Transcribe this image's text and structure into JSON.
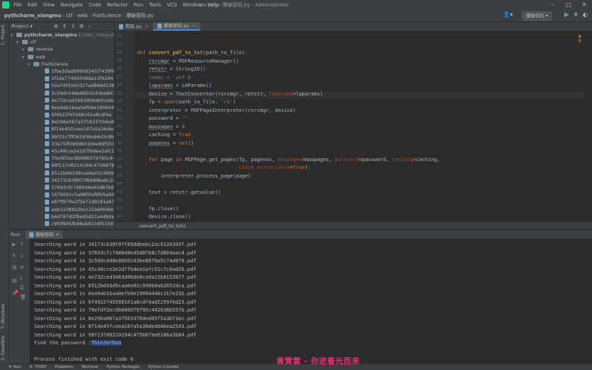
{
  "menubar": {
    "items": [
      "File",
      "Edit",
      "View",
      "Navigate",
      "Code",
      "Refactor",
      "Run",
      "Tools",
      "VCS",
      "Window",
      "Help"
    ],
    "title": "cscy.py - 爆破密码.py - Administrator"
  },
  "navbar": {
    "crumbs": [
      "pythcharm_xiangmu",
      "ctf",
      "web",
      "FlatScience",
      "爆破密码.py"
    ],
    "run_config": "爆破密码 ▾"
  },
  "left_strip": {
    "project_tab": "1: Project",
    "structure_tab": "7: Structure",
    "favorites_tab": "2: Favorites"
  },
  "project": {
    "header": "Project ▾",
    "root": "pythcharm_xiangmu",
    "root_path": "E:\\dax_mal\\pythch",
    "folders": [
      "ctf",
      "reverse",
      "web",
      "FlatScience"
    ],
    "files": [
      "1f0e3dad99908345f7439f8",
      "1f1de77400508da13f4294",
      "02e74f10e0327ad868d138f",
      "3c59dc048e8850243be8079",
      "4e732ced3463d06de0ca9a1",
      "6ea9ab1baa0efb9e190944",
      "6f4922f45568161a8cdf4a",
      "8e296a067a37563370ded0",
      "8f14e45fceea167a5a36ded",
      "9bf31c7ff062936a96d3c8b",
      "33e75ff09dd601bbe69f351",
      "45c48cce2e2d7fbdea1afc5",
      "70efdf2ec9b086079795c44",
      "98f13708210194c475687be",
      "6512bd43d9caa6e02c990b0",
      "34173cb38f07f89ddbebc2a",
      "37693cfc748049e45d87b8c",
      "1679091c5a880faf6fb5e608",
      "a87ff679a2f3e71d9181a67b",
      "aab3238922bcc25a6f606eb5",
      "b6d767d2f8ed5d21a44b0e5",
      "c9f0f895fb98ab9159f51fd0"
    ]
  },
  "editor": {
    "tabs": [
      "爬取.py",
      "爆破密码.py"
    ],
    "line_numbers": [
      "22",
      "23",
      "24",
      "25",
      "26",
      "27",
      "28",
      "29",
      "30",
      "31",
      "32",
      "33",
      "34",
      "35",
      "36",
      "37",
      "38",
      "39",
      "40",
      "41",
      "42",
      "43",
      "44",
      "45",
      "46"
    ],
    "code_lines": [
      {
        "n": "24",
        "html": "<span class='kw'>def </span><span class='fn'>convert_pdf_to_txt</span>(path_to_file):"
      },
      {
        "n": "25",
        "html": "    <span class='ul'>rsrcmgr</span> = PDFResourceManager()"
      },
      {
        "n": "26",
        "html": "    <span class='ul'>retstr</span> = StringIO()"
      },
      {
        "n": "27",
        "html": "    <span style='color:#808080'>codec = 'utf-8'</span>"
      },
      {
        "n": "28",
        "html": "    <span class='ul'>laparams</span> = LAParams()"
      },
      {
        "n": "29",
        "html": "    device = TextConverter(rsrcmgr, retstr, <span class='prm'>laparams</span>=laparams)"
      },
      {
        "n": "30",
        "html": "    fp = <span class='kw'>open</span>(path_to_file, <span class='str'>'rb'</span>)"
      },
      {
        "n": "31",
        "html": "    interpreter = PDFPageInterpreter(rsrcmgr, device)"
      },
      {
        "n": "32",
        "html": "    password = <span class='str'>\"\"</span>"
      },
      {
        "n": "33",
        "html": "    <span class='ul'>maxpages</span> = <span class='num'>0</span>"
      },
      {
        "n": "34",
        "html": "    caching = <span class='kw'>True</span>"
      },
      {
        "n": "35",
        "html": "    <span class='ul'>pagenos</span> = <span class='kw'>set</span>()"
      },
      {
        "n": "36",
        "html": ""
      },
      {
        "n": "37",
        "html": "    <span class='kw'>for </span>page <span class='kw'>in </span>PDFPage.get_pages(fp, pagenos, <span class='prm'>maxpages</span>=maxpages, <span class='prm'>password</span>=password, <span class='prm'>caching</span>=caching,"
      },
      {
        "n": "38",
        "html": "                                  <span class='prm'>check_extractable</span>=<span class='kw'>True</span>):"
      },
      {
        "n": "39",
        "html": "        interpreter.process_page(page)"
      },
      {
        "n": "40",
        "html": ""
      },
      {
        "n": "41",
        "html": "    text = retstr.getvalue()"
      },
      {
        "n": "42",
        "html": ""
      },
      {
        "n": "43",
        "html": "    fp.close()"
      },
      {
        "n": "44",
        "html": "    device.close()"
      }
    ],
    "breadcrumb": "convert_pdf_to_txt()",
    "warning": "▲ 8"
  },
  "run": {
    "label": "Run:",
    "tab": "爆破密码",
    "lines": [
      "Searching word in 34173cb38f07f89ddbebc2ac9128303f.pdf",
      "Searching word in 37693cfc748049e45d87b8c7d8b9aacd.pdf",
      "Searching word in 3c59dc048e8850243be8079a5c74d079.pdf",
      "Searching word in 45c48cce2e2d7fbdea1afc51c7c6ad26.pdf",
      "Searching word in 4e732ced3463d06de0ca9a15b6153677.pdf",
      "Searching word in 6512bd43d9caa6e02c990b0a82652dca.pdf",
      "Searching word in 6ea9ab1baa0efb9e19094440c317e21b.pdf",
      "Searching word in 6f4922f45568161a8cdf4ad2299f6d23.pdf",
      "Searching word in 70efdf2ec9b086079795c442636b55fb.pdf",
      "Searching word in 8e296a067a37563370ded05f5a3bf3ec.pdf",
      "Searching word in 8f14e45fceea167a5a36dedd4bea2543.pdf",
      "Searching word in 98f13708210194c475687be6106a3b84.pdf"
    ],
    "found_prefix": "Find the password :",
    "found_value": "ThinJerboa",
    "exit": "Process finished with exit code 0"
  },
  "bottombar": {
    "items": [
      "4: Run",
      "6: TODO",
      "Problems",
      "Terminal",
      "Python Packages",
      "Python Console"
    ]
  },
  "subtitle": "黄霄雲 - 你逆着光而来"
}
